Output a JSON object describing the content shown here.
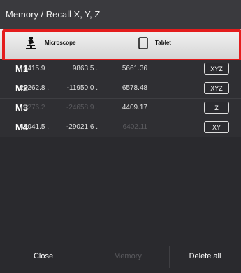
{
  "title": "Memory / Recall X, Y, Z",
  "devices": {
    "microscope": "Microscope",
    "tablet": "Tablet"
  },
  "rows": [
    {
      "mem": "M1",
      "x": "-14415.9 .",
      "y": "9863.5 .",
      "z": "5661.36",
      "axis": "XYZ"
    },
    {
      "mem": "M2",
      "x": "-28262.8 .",
      "y": "-11950.0 .",
      "z": "6578.48",
      "axis": "XYZ"
    },
    {
      "mem": "M3",
      "x": "2276.2 .",
      "y": "-24658.9 .",
      "z": "4409.17",
      "axis": "Z"
    },
    {
      "mem": "M4",
      "x": "47041.5 .",
      "y": "-29021.6 .",
      "z": "6402.11",
      "axis": "XY"
    }
  ],
  "footer": {
    "close": "Close",
    "memory": "Memory",
    "delete_all": "Delete all"
  },
  "colors": {
    "highlight": "#e41d1d",
    "background": "#2a2a2e"
  }
}
